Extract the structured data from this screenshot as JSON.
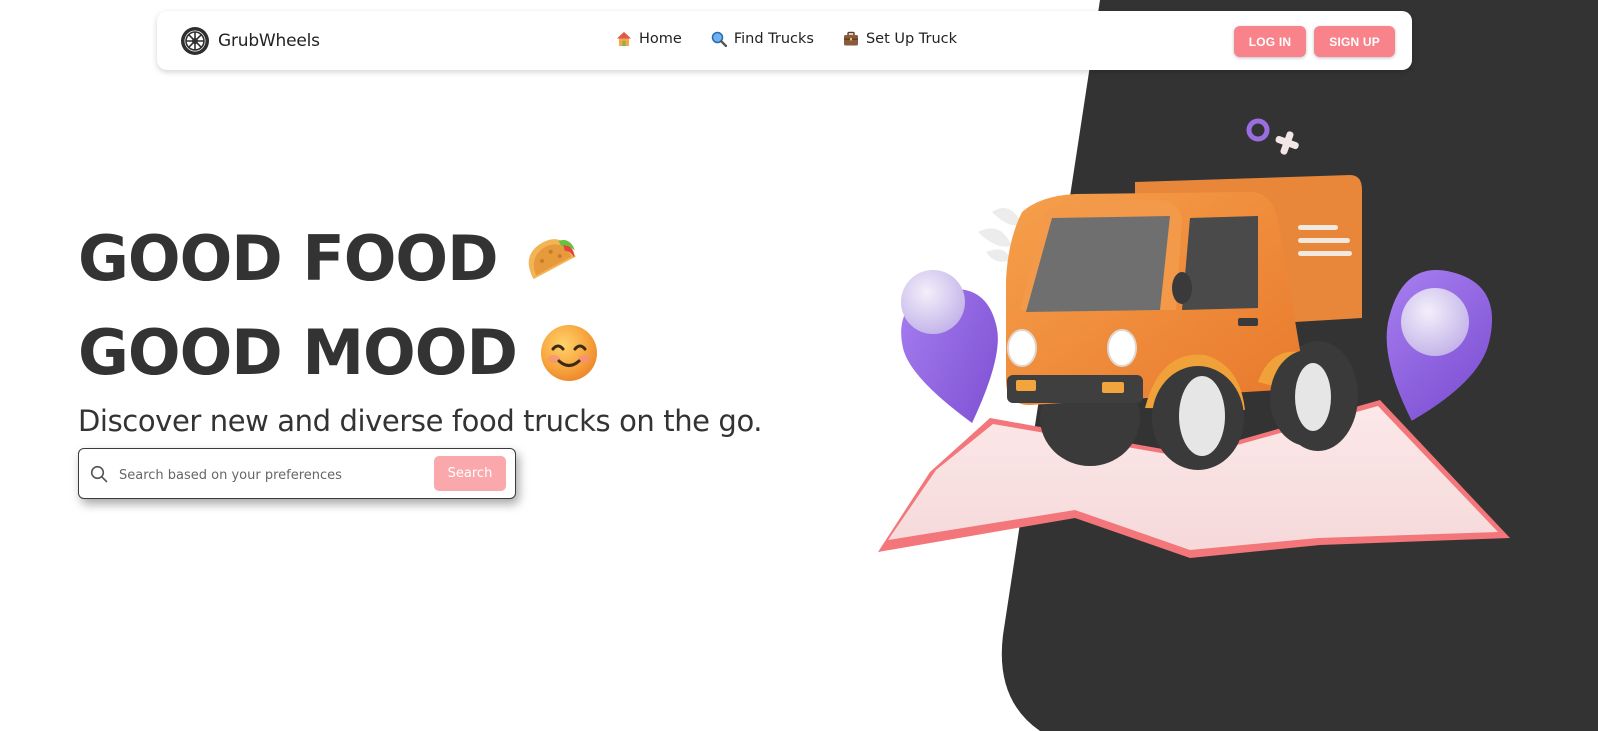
{
  "nav": {
    "brand": "GrubWheels",
    "links": [
      {
        "label": "Home",
        "icon": "house-icon"
      },
      {
        "label": "Find Trucks",
        "icon": "magnifier-icon"
      },
      {
        "label": "Set Up Truck",
        "icon": "briefcase-icon"
      }
    ],
    "login_label": "LOG IN",
    "signup_label": "SIGN UP"
  },
  "hero": {
    "line1": "GOOD FOOD",
    "line1_emoji": "taco-emoji",
    "line2": "GOOD MOOD",
    "line2_emoji": "smiling-face-emoji",
    "subtitle": "Discover new and diverse food trucks on the go."
  },
  "search": {
    "placeholder": "Search based on your preferences",
    "value": "",
    "button_label": "Search"
  },
  "colors": {
    "accent": "#f8838b",
    "search_button": "#fba8ad",
    "text_dark": "#333333",
    "dark_background": "#333333",
    "truck": "#f08a3c",
    "pin": "#9b6ee0",
    "map": "#f3767a"
  }
}
